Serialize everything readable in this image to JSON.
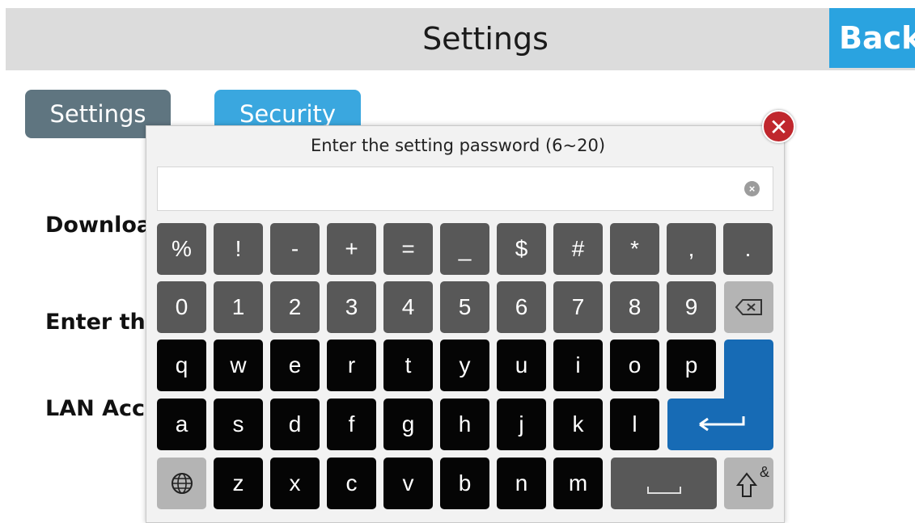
{
  "header": {
    "title": "Settings",
    "back_label": "Back"
  },
  "tabs": [
    {
      "label": "Settings"
    },
    {
      "label": "Security"
    }
  ],
  "background_labels": [
    "Downloa",
    "Enter the",
    "LAN Acc"
  ],
  "dialog": {
    "title": "Enter the setting password (6~20)",
    "password_value": "",
    "clear_icon": "clear-input-icon",
    "close_icon": "close-icon"
  },
  "keyboard": {
    "symbol_row": [
      "%",
      "!",
      "-",
      "+",
      "=",
      "_",
      "$",
      "#",
      "*",
      ",",
      "."
    ],
    "number_row": [
      "0",
      "1",
      "2",
      "3",
      "4",
      "5",
      "6",
      "7",
      "8",
      "9"
    ],
    "backspace_icon": "backspace-icon",
    "row_q": [
      "q",
      "w",
      "e",
      "r",
      "t",
      "y",
      "u",
      "i",
      "o",
      "p"
    ],
    "row_a": [
      "a",
      "s",
      "d",
      "f",
      "g",
      "h",
      "j",
      "k",
      "l"
    ],
    "row_z": [
      "z",
      "x",
      "c",
      "v",
      "b",
      "n",
      "m"
    ],
    "globe_icon": "globe-icon",
    "space_icon": "space-icon",
    "shift_icon": "shift-symbols-icon",
    "shift_mark": "&",
    "enter_icon": "enter-icon",
    "colors": {
      "gray_key": "#585858",
      "black_key": "#050505",
      "enter_key": "#176bb5",
      "accent": "#2aa3e0"
    }
  }
}
